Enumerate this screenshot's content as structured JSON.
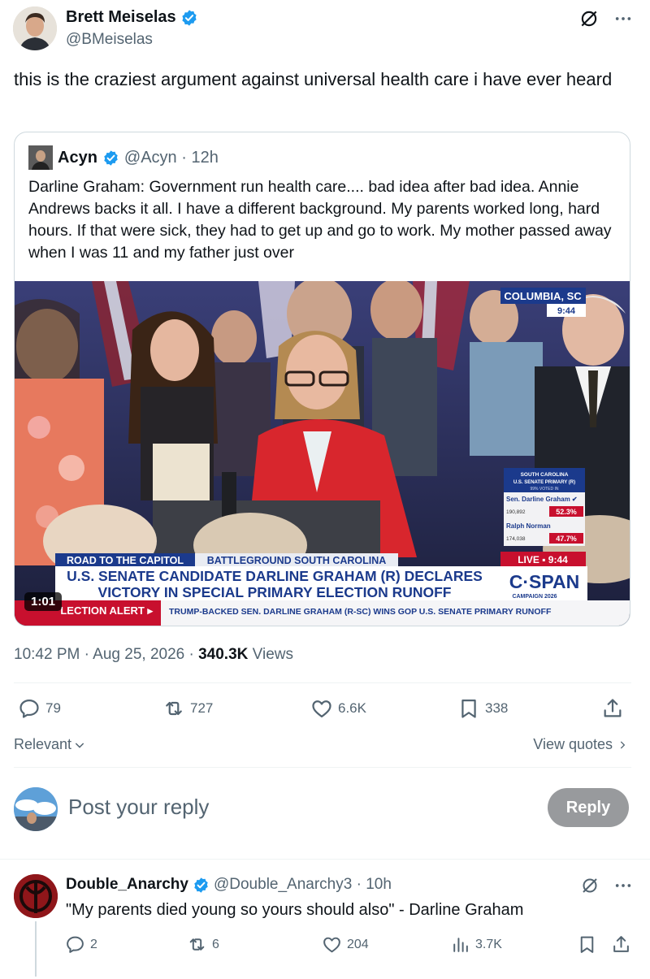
{
  "author": {
    "name": "Brett Meiselas",
    "handle": "@BMeiselas"
  },
  "tweet": {
    "text": "this is the craziest argument against universal health care i have ever heard"
  },
  "quote": {
    "name": "Acyn",
    "meta": "@Acyn · 12h",
    "text": "Darline Graham: Government run health care.... bad idea after bad idea. Annie Andrews backs it all. I have a different background. My parents worked long, hard hours. If that were sick, they had to get up and go to work. My mother passed away when I was 11 and my father just over",
    "video": {
      "duration": "1:01",
      "location": "COLUMBIA, SC",
      "time": "9:44",
      "road_label": "ROAD TO THE CAPITOL",
      "battleground_label": "BATTLEGROUND SOUTH CAROLINA",
      "headline_line1": "U.S. SENATE CANDIDATE DARLINE GRAHAM (R) DECLARES",
      "headline_line2": "VICTORY IN SPECIAL PRIMARY ELECTION RUNOFF",
      "alert_label": "LECTION ALERT ▸",
      "ticker": "TRUMP-BACKED SEN. DARLINE GRAHAM (R-SC) WINS GOP U.S. SENATE PRIMARY RUNOFF",
      "network": "C·SPAN",
      "network_sub": "CAMPAIGN 2026",
      "live_label": "LIVE ▪ 9:44",
      "results_title": "SOUTH CAROLINA",
      "results_subtitle": "U.S. SENATE PRIMARY (R)",
      "results_reporting": "99% VOTED IN",
      "candidates": [
        {
          "name": "Sen. Darline Graham ✔",
          "votes": "190,892",
          "pct": "52.3%"
        },
        {
          "name": "Ralph Norman",
          "votes": "174,038",
          "pct": "47.7%"
        }
      ]
    }
  },
  "meta": {
    "time_date": "10:42 PM · Aug 25, 2026 · ",
    "views_count": "340.3K",
    "views_label": " Views"
  },
  "stats": {
    "replies": "79",
    "reposts": "727",
    "likes": "6.6K",
    "bookmarks": "338"
  },
  "sort": {
    "label": "Relevant"
  },
  "view_quotes": "View quotes",
  "composer": {
    "placeholder": "Post your reply",
    "button": "Reply"
  },
  "reply": {
    "name": "Double_Anarchy",
    "meta": "@Double_Anarchy3 · 10h",
    "text": "\"My parents died young so yours should also\" - Darline Graham",
    "stats": {
      "replies": "2",
      "reposts": "6",
      "likes": "204",
      "views": "3.7K"
    }
  },
  "colors": {
    "verified": "#1d9bf0",
    "secondary_text": "#536471",
    "cspan_red": "#c8102e",
    "cspan_blue": "#1b3a8c"
  }
}
